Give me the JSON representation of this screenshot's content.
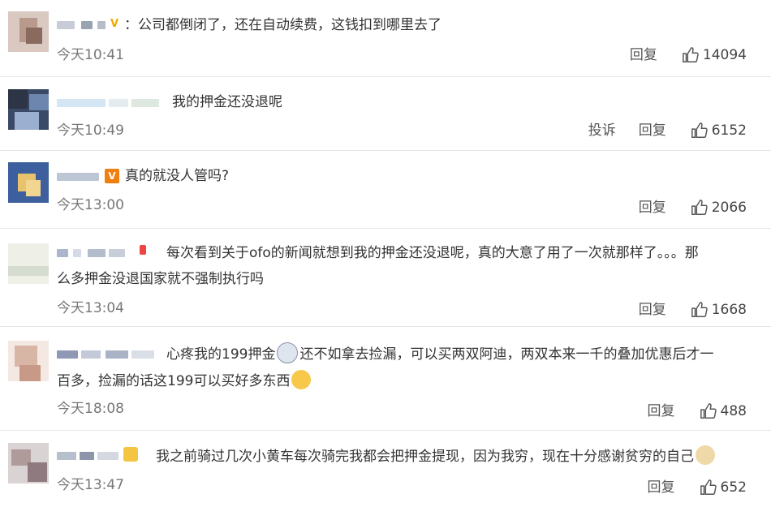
{
  "comments": [
    {
      "text": "公司都倒闭了，还在自动续费，这钱扣到哪里去了",
      "time": "今天10:41",
      "reply": "回复",
      "likes": "14094"
    },
    {
      "text": "我的押金还没退呢",
      "time": "今天10:49",
      "report": "投诉",
      "reply": "回复",
      "likes": "6152"
    },
    {
      "text": "真的就没人管吗?",
      "time": "今天13:00",
      "reply": "回复",
      "likes": "2066"
    },
    {
      "text_a": "每次看到关于ofo的新闻就想到我的押金还没退呢，真的大意了用了一次就那样了。。。那",
      "text_b": "么多押金没退国家就不强制执行吗",
      "time": "今天13:04",
      "reply": "回复",
      "likes": "1668"
    },
    {
      "text_a": "心疼我的199押金",
      "text_b": "还不如拿去捡漏，可以买两双阿迪，两双本来一千的叠加优惠后才一",
      "text_c": "百多，捡漏的话这199可以买好多东西",
      "time": "今天18:08",
      "reply": "回复",
      "likes": "488"
    },
    {
      "text": "我之前骑过几次小黄车每次骑完我都会把押金提现，因为我穷，现在十分感谢贫穷的自己",
      "time": "今天13:47",
      "reply": "回复",
      "likes": "652"
    }
  ],
  "colors": {
    "divider": "#e6e6e6",
    "time": "#777777",
    "text": "#333333",
    "vip_gold": "#f2a900",
    "vip_orange": "#f07f0f"
  },
  "icons": {
    "like": "thumbs-up-icon",
    "vip": "vip-badge-icon"
  }
}
